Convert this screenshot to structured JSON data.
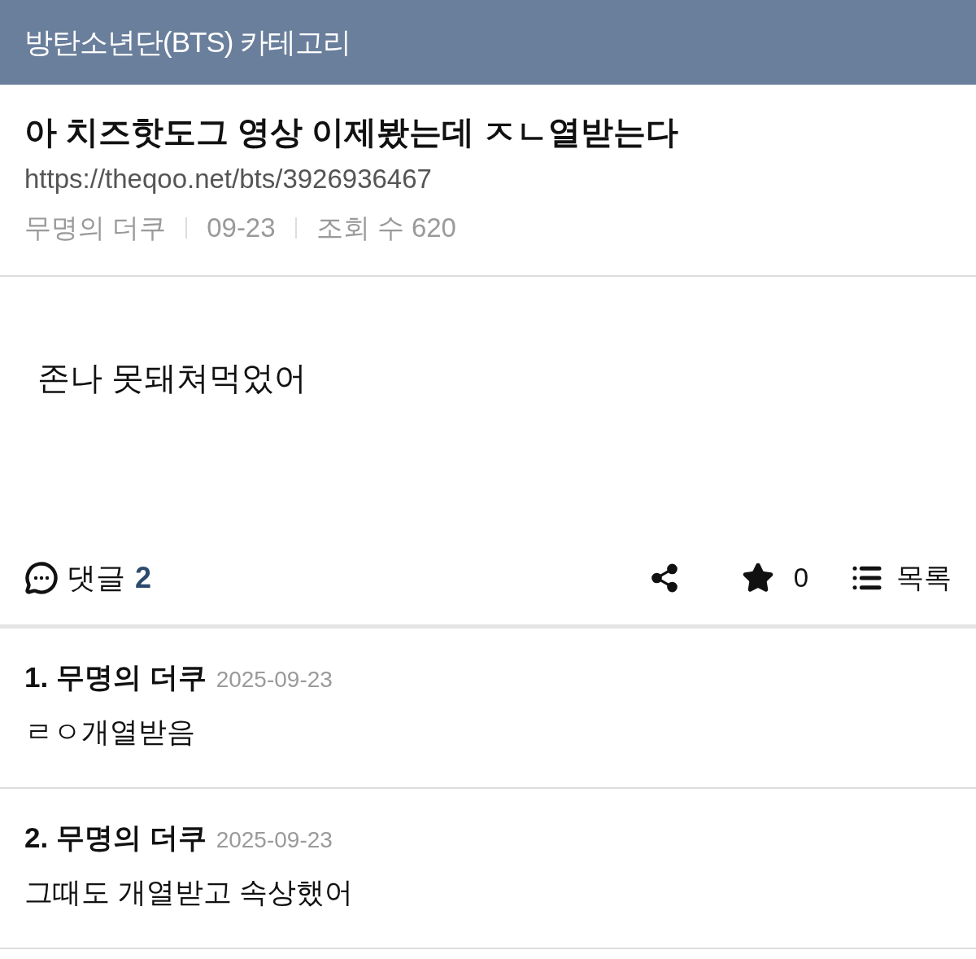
{
  "header": {
    "title": "방탄소년단(BTS) 카테고리"
  },
  "post": {
    "title": "아 치즈핫도그 영상 이제봤는데 ㅈㄴ열받는다",
    "url": "https://theqoo.net/bts/3926936467",
    "meta": [
      "무명의 더쿠",
      "09-23",
      "조회 수 620"
    ],
    "body": "존나 못돼쳐먹었어"
  },
  "actions": {
    "comments_label": "댓글",
    "comments_count": "2",
    "star_count": "0",
    "list_label": "목록"
  },
  "comments": [
    {
      "label": "1. 무명의 더쿠",
      "date": "2025-09-23",
      "text": "ㄹㅇ개열받음"
    },
    {
      "label": "2. 무명의 더쿠",
      "date": "2025-09-23",
      "text": "그때도 개열받고 속상했어"
    }
  ]
}
